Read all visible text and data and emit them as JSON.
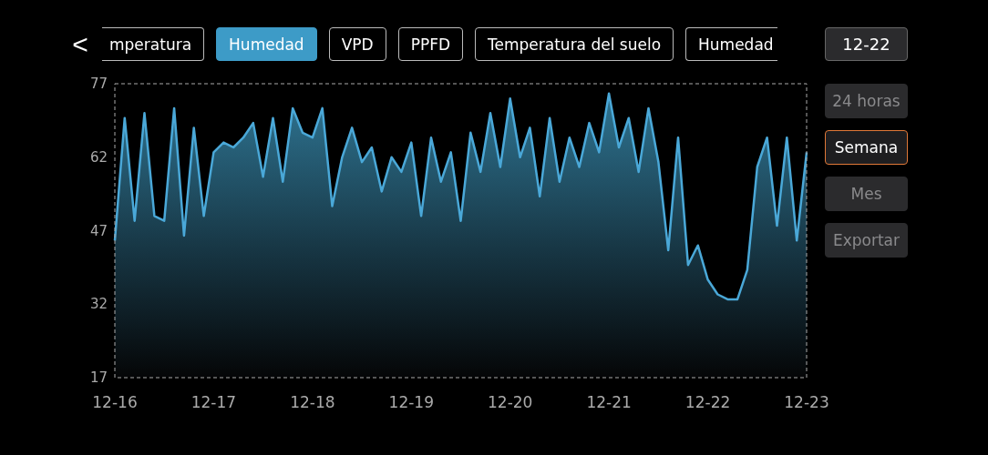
{
  "back_button": {
    "label": "<"
  },
  "tabs": [
    {
      "label": "mperatura",
      "selected": false,
      "kind": "leftcut"
    },
    {
      "label": "Humedad",
      "selected": true,
      "kind": "full"
    },
    {
      "label": "VPD",
      "selected": false,
      "kind": "full"
    },
    {
      "label": "PPFD",
      "selected": false,
      "kind": "full"
    },
    {
      "label": "Temperatura del suelo",
      "selected": false,
      "kind": "full"
    },
    {
      "label": "Humedad",
      "selected": false,
      "kind": "rightcut"
    }
  ],
  "date_button": "12-22",
  "ranges": [
    {
      "label": "24 horas",
      "selected": false,
      "disabled": true
    },
    {
      "label": "Semana",
      "selected": true,
      "disabled": false
    },
    {
      "label": "Mes",
      "selected": false,
      "disabled": true
    }
  ],
  "export_button": {
    "label": "Exportar",
    "disabled": true
  },
  "chart_data": {
    "type": "area",
    "ylim": [
      17,
      77
    ],
    "yticks": [
      17,
      32,
      47,
      62,
      77
    ],
    "categories": [
      "12-16",
      null,
      null,
      null,
      null,
      null,
      null,
      null,
      null,
      null,
      "12-17",
      null,
      null,
      null,
      null,
      null,
      null,
      null,
      null,
      null,
      "12-18",
      null,
      null,
      null,
      null,
      null,
      null,
      null,
      null,
      null,
      "12-19",
      null,
      null,
      null,
      null,
      null,
      null,
      null,
      null,
      null,
      "12-20",
      null,
      null,
      null,
      null,
      null,
      null,
      null,
      null,
      null,
      "12-21",
      null,
      null,
      null,
      null,
      null,
      null,
      null,
      null,
      null,
      "12-22",
      null,
      null,
      null,
      null,
      null,
      null,
      null,
      null,
      null,
      "12-23"
    ],
    "series": [
      {
        "color": "#4aa8d8",
        "values": [
          45,
          70,
          49,
          71,
          50,
          49,
          72,
          46,
          68,
          50,
          63,
          65,
          64,
          66,
          69,
          58,
          70,
          57,
          72,
          67,
          66,
          72,
          52,
          62,
          68,
          61,
          64,
          55,
          62,
          59,
          65,
          50,
          66,
          57,
          63,
          49,
          67,
          59,
          71,
          60,
          74,
          62,
          68,
          54,
          70,
          57,
          66,
          60,
          69,
          63,
          75,
          64,
          70,
          59,
          72,
          61,
          43,
          66,
          40,
          44,
          37,
          34,
          33,
          33,
          39,
          60,
          66,
          48,
          66,
          45,
          63
        ]
      }
    ]
  }
}
